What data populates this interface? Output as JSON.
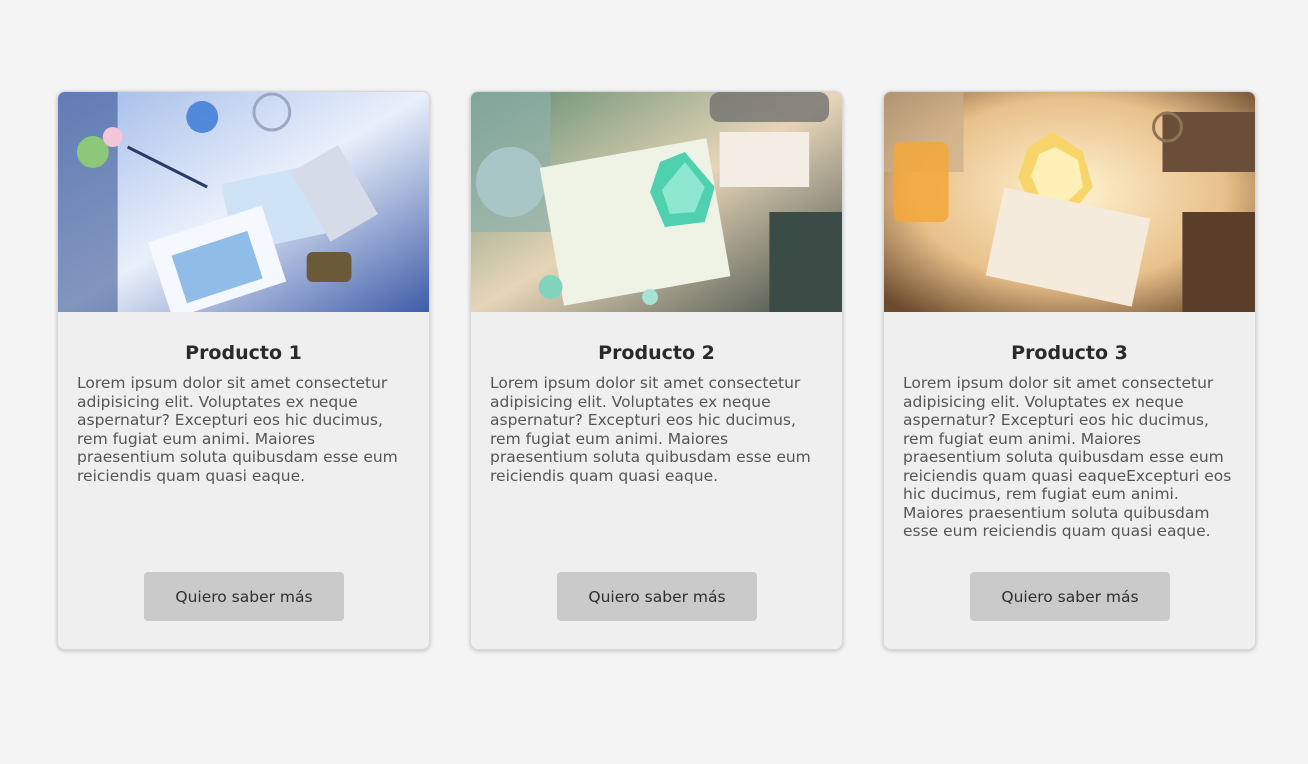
{
  "products": [
    {
      "title": "Producto 1",
      "description": "Lorem ipsum dolor sit amet consectetur adipisicing elit. Voluptates ex neque aspernatur? Excepturi eos hic ducimus, rem fugiat eum animi. Maiores praesentium soluta quibusdam esse eum reiciendis quam quasi eaque.",
      "button_label": "Quiero saber más"
    },
    {
      "title": "Producto 2",
      "description": "Lorem ipsum dolor sit amet consectetur adipisicing elit. Voluptates ex neque aspernatur? Excepturi eos hic ducimus, rem fugiat eum animi. Maiores praesentium soluta quibusdam esse eum reiciendis quam quasi eaque.",
      "button_label": "Quiero saber más"
    },
    {
      "title": "Producto 3",
      "description": "Lorem ipsum dolor sit amet consectetur adipisicing elit. Voluptates ex neque aspernatur? Excepturi eos hic ducimus, rem fugiat eum animi. Maiores praesentium soluta quibusdam esse eum reiciendis quam quasi eaqueExcepturi eos hic ducimus, rem fugiat eum animi. Maiores praesentium soluta quibusdam esse eum reiciendis quam quasi eaque.",
      "button_label": "Quiero saber más"
    }
  ],
  "colors": {
    "page_background": "#f4f4f4",
    "card_background": "#efefef",
    "button_background": "#cacaca"
  }
}
